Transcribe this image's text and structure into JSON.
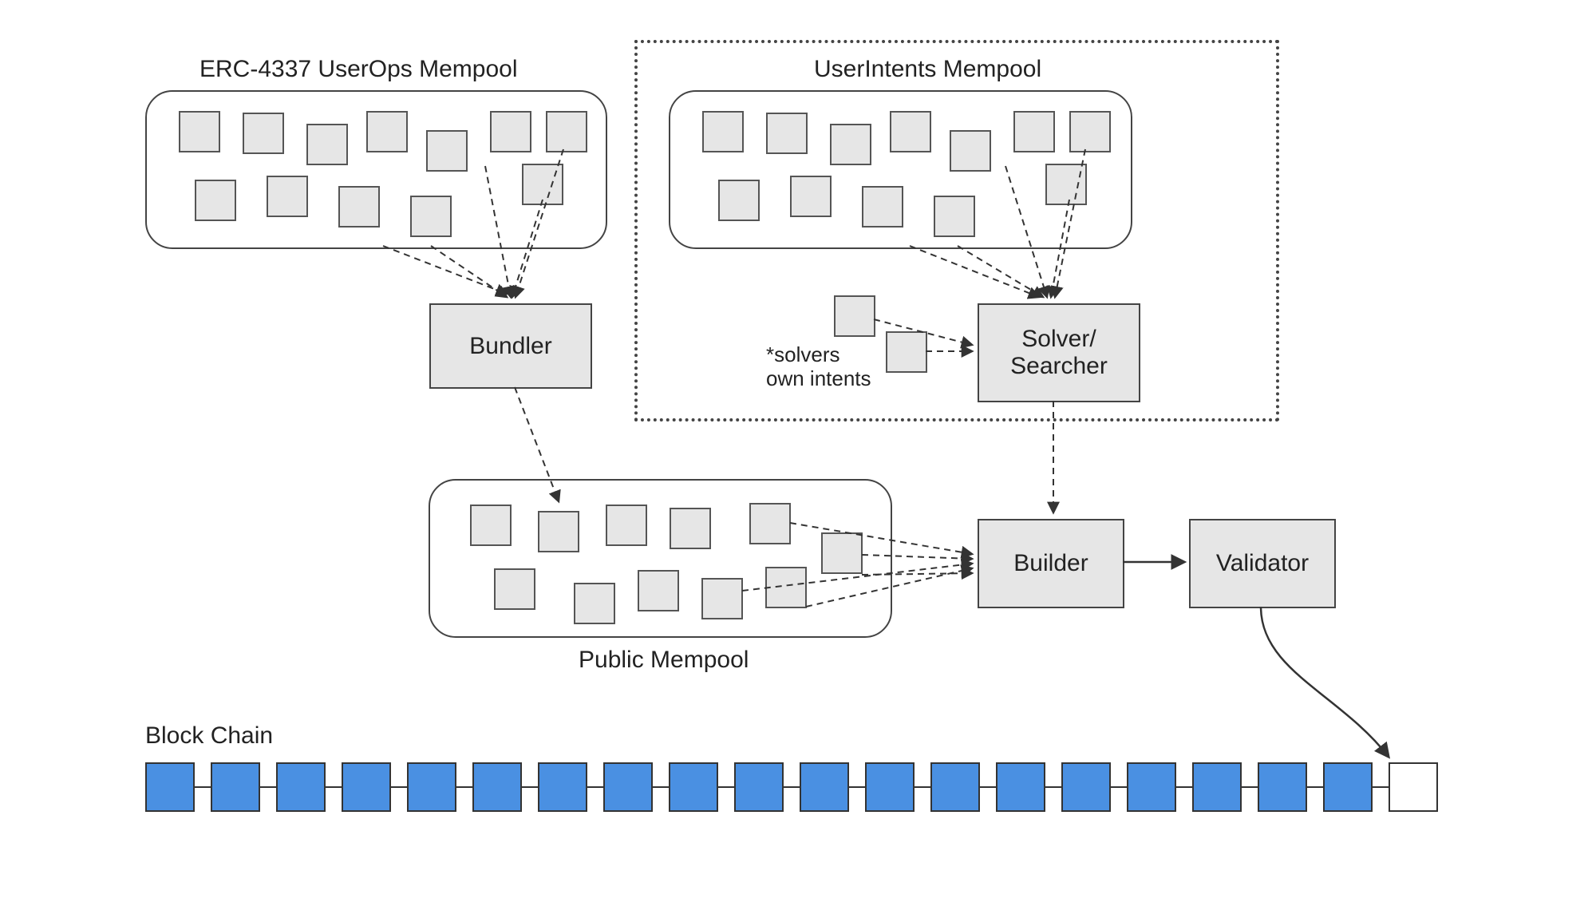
{
  "diagram": {
    "left_pool_title": "ERC-4337 UserOps Mempool",
    "right_pool_title": "UserIntents Mempool",
    "public_pool_title": "Public Mempool",
    "blockchain_title": "Block Chain",
    "solvers_note": "*solvers\nown intents",
    "bundler_label": "Bundler",
    "solver_label": "Solver/\nSearcher",
    "builder_label": "Builder",
    "validator_label": "Validator",
    "blockchain_block_count": 20,
    "colors": {
      "block_fill": "#4a90e2",
      "box_fill": "#e6e6e6",
      "stroke": "#444444"
    }
  }
}
